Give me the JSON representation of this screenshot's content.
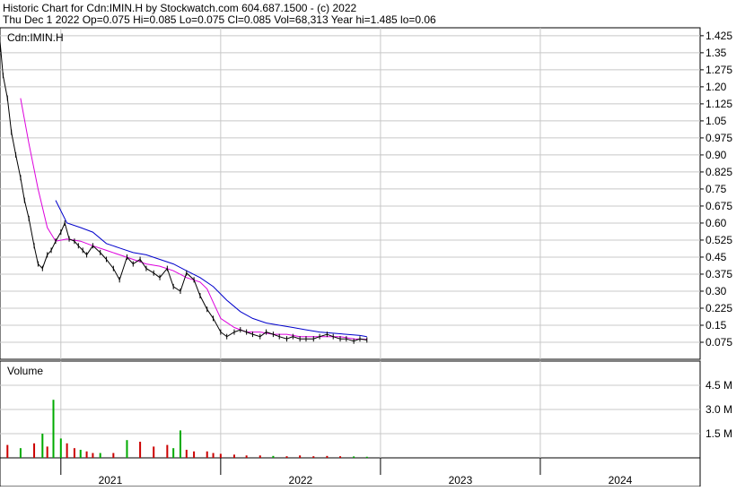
{
  "header": {
    "line1": "Historic Chart for Cdn:IMIN.H by Stockwatch.com 604.687.1500 - (c) 2022",
    "line2": "Thu Dec  1 2022  Op=0.075  Hi=0.085  Lo=0.075  Cl=0.085  Vol=68,313  Year hi=1.485  lo=0.06"
  },
  "price_panel": {
    "label": "Cdn:IMIN.H"
  },
  "volume_panel": {
    "label": "Volume"
  },
  "colors": {
    "price_line": "#000000",
    "ma_short": "#dd00dd",
    "ma_long": "#0000cc",
    "volume_up": "#00aa00",
    "volume_down": "#cc0000",
    "grid": "#c8c8c8"
  },
  "chart_data": [
    {
      "type": "line",
      "title": "Cdn:IMIN.H",
      "xlabel": "",
      "ylabel": "",
      "xlim": [
        "2020-08-15",
        "2024-12-31"
      ],
      "ylim": [
        0.0,
        1.46
      ],
      "yticks": [
        "1.425",
        "1.35",
        "1.275",
        "1.20",
        "1.125",
        "1.05",
        "0.975",
        "0.90",
        "0.825",
        "0.75",
        "0.675",
        "0.60",
        "0.525",
        "0.45",
        "0.375",
        "0.30",
        "0.225",
        "0.15",
        "0.075"
      ],
      "x_tick_labels": [
        "2021",
        "2022",
        "2023",
        "2024"
      ],
      "grid": true,
      "series": [
        {
          "id": "price",
          "x": [
            "2020-08-15",
            "2020-08-22",
            "2020-09-01",
            "2020-09-10",
            "2020-09-20",
            "2020-10-01",
            "2020-10-10",
            "2020-10-20",
            "2020-11-01",
            "2020-11-10",
            "2020-11-20",
            "2020-12-01",
            "2020-12-10",
            "2020-12-20",
            "2021-01-01",
            "2021-01-10",
            "2021-01-20",
            "2021-02-01",
            "2021-02-10",
            "2021-02-20",
            "2021-03-01",
            "2021-03-15",
            "2021-04-01",
            "2021-04-15",
            "2021-05-01",
            "2021-05-15",
            "2021-06-01",
            "2021-06-15",
            "2021-07-01",
            "2021-07-15",
            "2021-08-01",
            "2021-08-15",
            "2021-09-01",
            "2021-09-15",
            "2021-10-01",
            "2021-10-15",
            "2021-11-01",
            "2021-11-15",
            "2021-12-01",
            "2021-12-15",
            "2022-01-01",
            "2022-01-15",
            "2022-02-01",
            "2022-02-15",
            "2022-03-01",
            "2022-03-15",
            "2022-04-01",
            "2022-04-15",
            "2022-05-01",
            "2022-05-15",
            "2022-06-01",
            "2022-06-15",
            "2022-07-01",
            "2022-07-15",
            "2022-08-01",
            "2022-08-15",
            "2022-09-01",
            "2022-09-15",
            "2022-10-01",
            "2022-10-15",
            "2022-11-01",
            "2022-11-15",
            "2022-12-01"
          ],
          "y": [
            1.4,
            1.25,
            1.15,
            1.0,
            0.9,
            0.8,
            0.7,
            0.62,
            0.5,
            0.42,
            0.4,
            0.46,
            0.48,
            0.52,
            0.56,
            0.6,
            0.53,
            0.52,
            0.5,
            0.48,
            0.46,
            0.5,
            0.47,
            0.44,
            0.4,
            0.35,
            0.45,
            0.42,
            0.44,
            0.4,
            0.38,
            0.36,
            0.4,
            0.32,
            0.3,
            0.38,
            0.35,
            0.28,
            0.22,
            0.18,
            0.12,
            0.1,
            0.12,
            0.13,
            0.12,
            0.11,
            0.1,
            0.12,
            0.11,
            0.1,
            0.09,
            0.1,
            0.09,
            0.09,
            0.09,
            0.1,
            0.11,
            0.1,
            0.09,
            0.09,
            0.08,
            0.09,
            0.085
          ]
        },
        {
          "id": "ma_short",
          "x": [
            "2020-10-01",
            "2020-10-20",
            "2020-11-10",
            "2020-12-01",
            "2020-12-20",
            "2021-01-15",
            "2021-02-15",
            "2021-03-15",
            "2021-04-15",
            "2021-05-15",
            "2021-06-15",
            "2021-07-15",
            "2021-08-15",
            "2021-09-15",
            "2021-10-15",
            "2021-11-15",
            "2021-12-01",
            "2021-12-15",
            "2022-01-01",
            "2022-02-01",
            "2022-03-01",
            "2022-04-01",
            "2022-05-01",
            "2022-06-01",
            "2022-07-01",
            "2022-08-01",
            "2022-09-01",
            "2022-10-01",
            "2022-11-01",
            "2022-12-01"
          ],
          "y": [
            1.15,
            0.95,
            0.75,
            0.58,
            0.52,
            0.53,
            0.52,
            0.5,
            0.48,
            0.46,
            0.44,
            0.42,
            0.41,
            0.39,
            0.36,
            0.34,
            0.31,
            0.25,
            0.18,
            0.14,
            0.12,
            0.12,
            0.11,
            0.11,
            0.1,
            0.1,
            0.1,
            0.1,
            0.09,
            0.088
          ]
        },
        {
          "id": "ma_long",
          "x": [
            "2020-12-20",
            "2021-01-15",
            "2021-02-15",
            "2021-03-15",
            "2021-04-15",
            "2021-05-15",
            "2021-06-15",
            "2021-07-15",
            "2021-08-15",
            "2021-09-15",
            "2021-10-15",
            "2021-11-15",
            "2021-12-15",
            "2022-01-15",
            "2022-02-15",
            "2022-03-15",
            "2022-04-15",
            "2022-05-15",
            "2022-06-15",
            "2022-07-15",
            "2022-08-15",
            "2022-09-15",
            "2022-10-15",
            "2022-11-15",
            "2022-12-01"
          ],
          "y": [
            0.7,
            0.6,
            0.58,
            0.56,
            0.51,
            0.49,
            0.47,
            0.46,
            0.44,
            0.42,
            0.39,
            0.36,
            0.32,
            0.26,
            0.21,
            0.18,
            0.16,
            0.15,
            0.14,
            0.13,
            0.12,
            0.115,
            0.11,
            0.105,
            0.1
          ]
        }
      ]
    },
    {
      "type": "bar",
      "title": "Volume",
      "xlabel": "",
      "ylabel": "",
      "ylim": [
        0,
        6000000
      ],
      "yticks": [
        "4.5 M",
        "3.0 M",
        "1.5 M"
      ],
      "grid": true,
      "x": [
        "2020-09-01",
        "2020-10-01",
        "2020-11-01",
        "2020-11-20",
        "2020-12-01",
        "2020-12-15",
        "2021-01-01",
        "2021-01-15",
        "2021-02-01",
        "2021-02-15",
        "2021-03-01",
        "2021-03-15",
        "2021-04-01",
        "2021-05-01",
        "2021-06-01",
        "2021-07-01",
        "2021-08-01",
        "2021-09-01",
        "2021-09-15",
        "2021-10-01",
        "2021-10-15",
        "2021-11-01",
        "2021-12-01",
        "2021-12-15",
        "2022-01-01",
        "2022-02-01",
        "2022-03-01",
        "2022-04-01",
        "2022-05-01",
        "2022-06-01",
        "2022-07-01",
        "2022-08-01",
        "2022-09-01",
        "2022-10-01",
        "2022-11-01",
        "2022-12-01"
      ],
      "values": [
        800000,
        600000,
        900000,
        1500000,
        700000,
        3600000,
        1200000,
        900000,
        600000,
        500000,
        400000,
        300000,
        300000,
        300000,
        1100000,
        1000000,
        700000,
        800000,
        600000,
        1700000,
        500000,
        400000,
        400000,
        300000,
        250000,
        200000,
        150000,
        150000,
        120000,
        100000,
        150000,
        100000,
        120000,
        100000,
        90000,
        68313
      ],
      "direction": [
        "down",
        "up",
        "down",
        "up",
        "down",
        "up",
        "up",
        "down",
        "down",
        "up",
        "down",
        "down",
        "up",
        "down",
        "up",
        "down",
        "down",
        "down",
        "up",
        "up",
        "down",
        "down",
        "down",
        "down",
        "down",
        "down",
        "down",
        "down",
        "up",
        "down",
        "down",
        "down",
        "down",
        "down",
        "up",
        "up"
      ]
    }
  ]
}
